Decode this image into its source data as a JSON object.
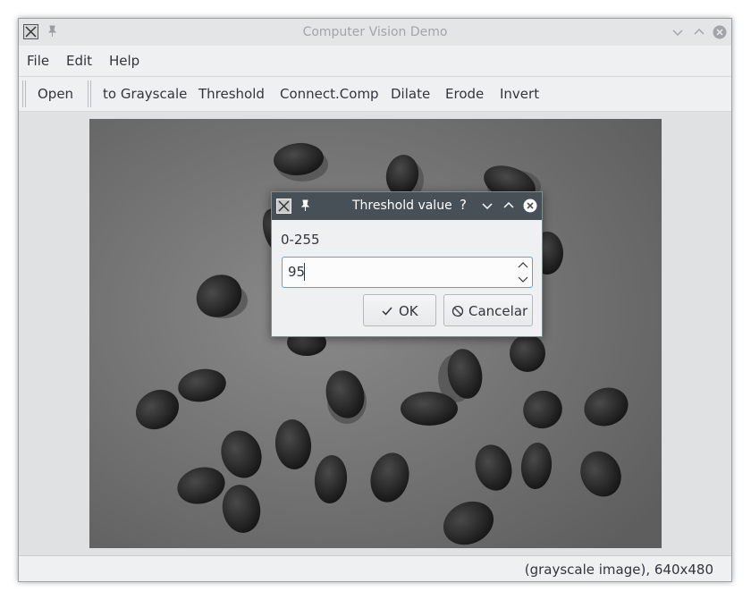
{
  "window": {
    "title": "Computer Vision Demo"
  },
  "menu": [
    "File",
    "Edit",
    "Help"
  ],
  "toolbar": {
    "open": "Open",
    "grayscale": "to Grayscale",
    "threshold": "Threshold",
    "connected": "Connect.Comp",
    "dilate": "Dilate",
    "erode": "Erode",
    "invert": "Invert"
  },
  "status": {
    "text": "(grayscale image), 640x480"
  },
  "dialog": {
    "title": "Threshold value",
    "help": "?",
    "label": "0-255",
    "value": "95",
    "ok": "OK",
    "cancel": "Cancelar"
  },
  "colors": {
    "accent": "#3daee9",
    "dialog_titlebar": "#475057",
    "window_bg": "#eff0f1"
  },
  "icons": [
    "app-icon",
    "pin-icon",
    "minimize-icon",
    "maximize-icon",
    "close-icon",
    "check-icon",
    "cancel-icon",
    "spin-up-icon",
    "spin-down-icon"
  ]
}
